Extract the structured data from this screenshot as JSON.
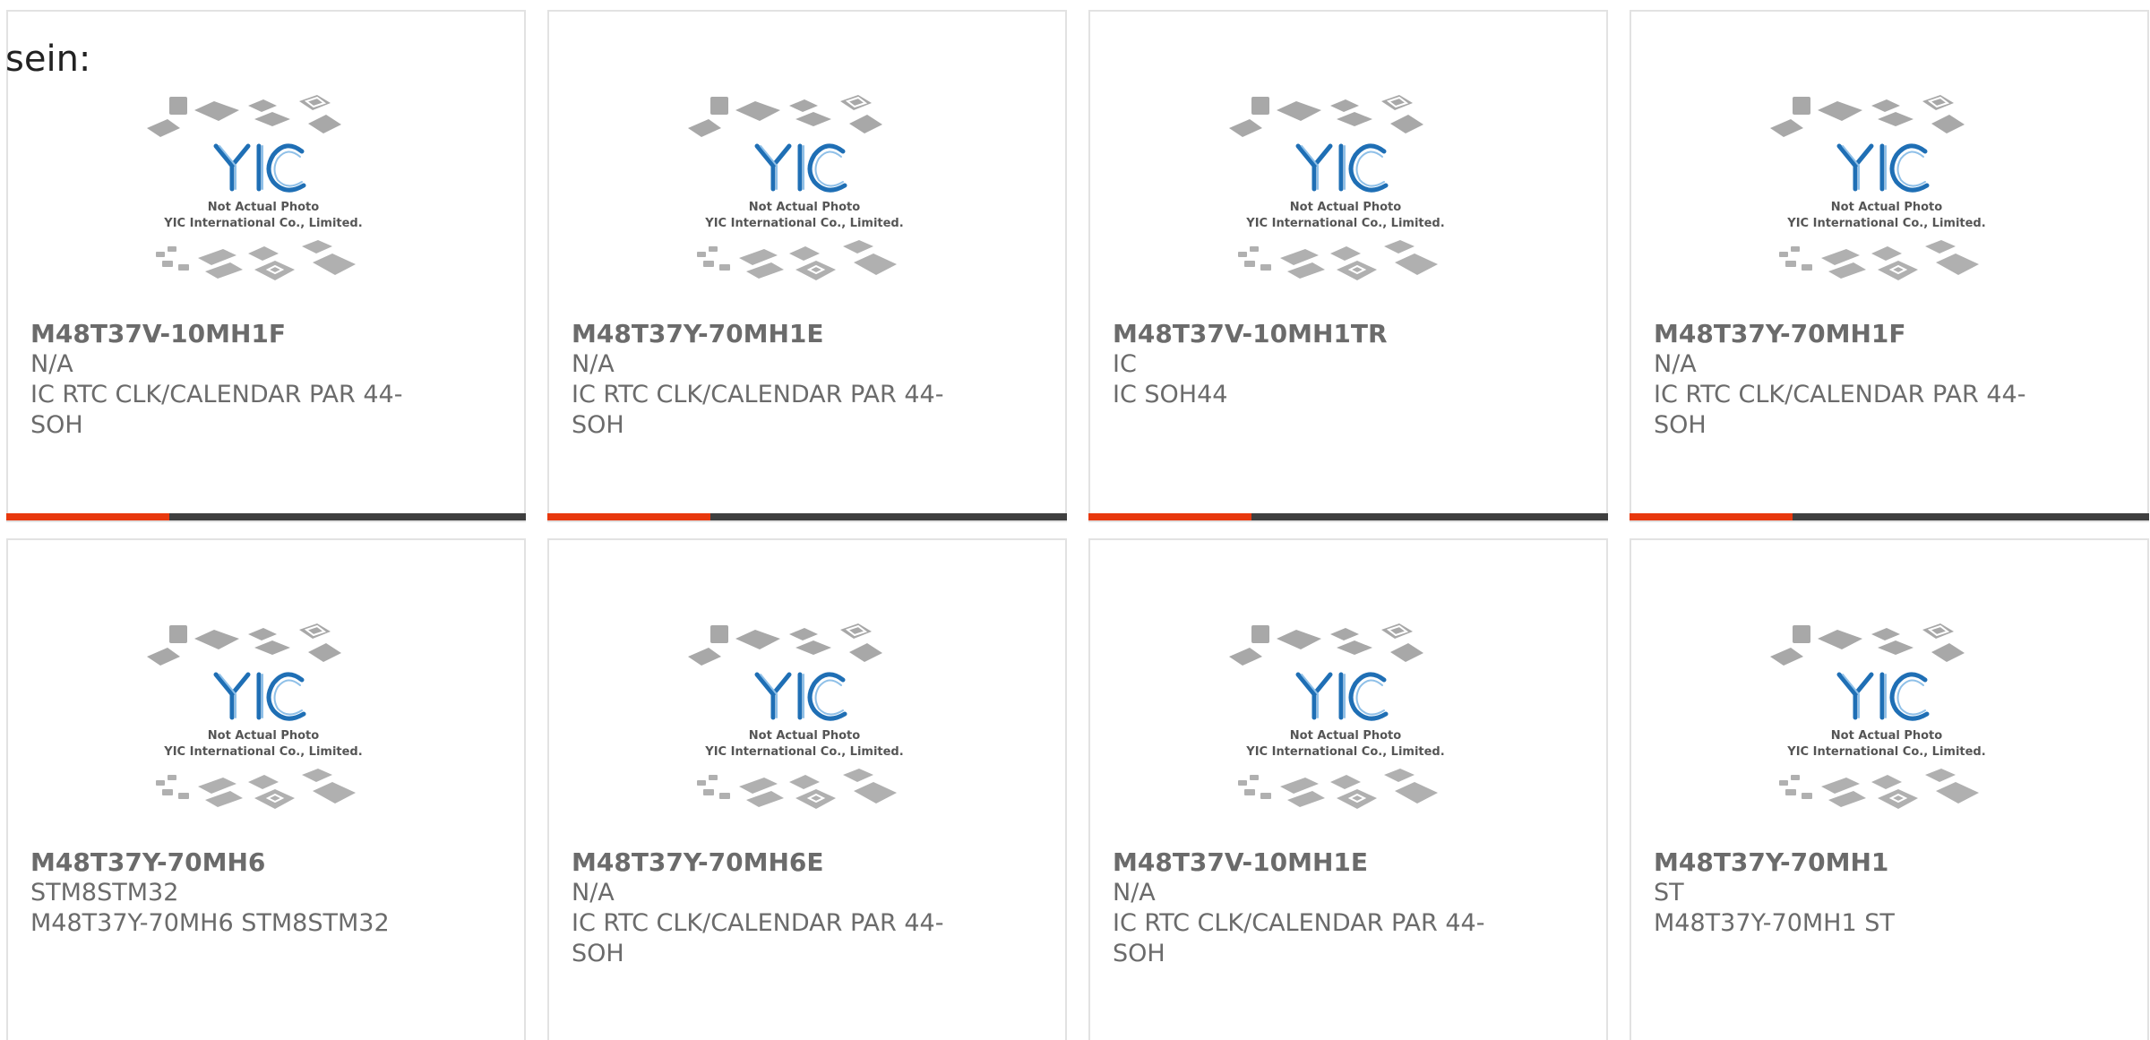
{
  "intro_text": "sein:",
  "image": {
    "caption_line1": "Not Actual Photo",
    "caption_line2": "YIC International Co., Limited.",
    "logo_text": "YIC"
  },
  "colors": {
    "accent": "#e8380d",
    "bar": "#3f3f3f",
    "logo_blue": "#1f6fb5"
  },
  "products": [
    {
      "part": "M48T37V-10MH1F",
      "manufacturer": "N/A",
      "description": "IC RTC CLK/CALENDAR PAR 44-SOH"
    },
    {
      "part": "M48T37Y-70MH1E",
      "manufacturer": "N/A",
      "description": "IC RTC CLK/CALENDAR PAR 44-SOH"
    },
    {
      "part": "M48T37V-10MH1TR",
      "manufacturer": "IC",
      "description": "IC SOH44"
    },
    {
      "part": "M48T37Y-70MH1F",
      "manufacturer": "N/A",
      "description": "IC RTC CLK/CALENDAR PAR 44-SOH"
    },
    {
      "part": "M48T37Y-70MH6",
      "manufacturer": "STM8STM32",
      "description": "M48T37Y-70MH6 STM8STM32"
    },
    {
      "part": "M48T37Y-70MH6E",
      "manufacturer": "N/A",
      "description": "IC RTC CLK/CALENDAR PAR 44-SOH"
    },
    {
      "part": "M48T37V-10MH1E",
      "manufacturer": "N/A",
      "description": "IC RTC CLK/CALENDAR PAR 44-SOH"
    },
    {
      "part": "M48T37Y-70MH1",
      "manufacturer": "ST",
      "description": "M48T37Y-70MH1 ST"
    }
  ]
}
